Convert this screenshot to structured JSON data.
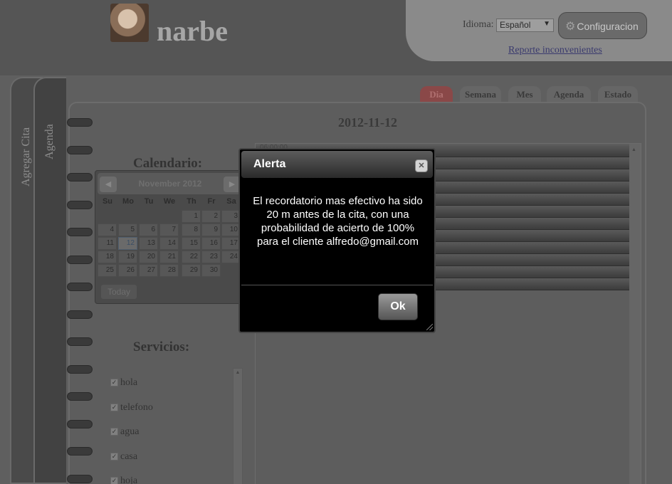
{
  "header": {
    "brand": "narbe",
    "language_label": "Idioma:",
    "language_selected": "Español",
    "config_button": "Configuracion",
    "report_link": "Reporte inconvenientes"
  },
  "side_tabs": [
    "Agregar Cita",
    "Agenda"
  ],
  "view_tabs": [
    "Dia",
    "Semana",
    "Mes",
    "Agenda",
    "Estado"
  ],
  "active_view_tab": "Dia",
  "main": {
    "date_title": "2012-11-12",
    "calendar_title": "Calendario:",
    "services_title": "Servicios:"
  },
  "calendar": {
    "month_label": "November 2012",
    "weekdays": [
      "Su",
      "Mo",
      "Tu",
      "We",
      "Th",
      "Fr",
      "Sa"
    ],
    "days": [
      "1",
      "2",
      "3",
      "4",
      "5",
      "6",
      "7",
      "8",
      "9",
      "10",
      "11",
      "12",
      "13",
      "14",
      "15",
      "16",
      "17",
      "18",
      "19",
      "20",
      "21",
      "22",
      "23",
      "24",
      "25",
      "26",
      "27",
      "28",
      "29",
      "30"
    ],
    "first_weekday_index": 4,
    "selected_day": "12",
    "today_button": "Today"
  },
  "services": [
    {
      "label": "hola",
      "checked": true
    },
    {
      "label": "telefono",
      "checked": true
    },
    {
      "label": "agua",
      "checked": true
    },
    {
      "label": "casa",
      "checked": true
    },
    {
      "label": "hoja",
      "checked": true
    }
  ],
  "schedule": {
    "first_slot_time": "06:00:00",
    "slot_count": 12
  },
  "modal": {
    "title": "Alerta",
    "message": "El recordatorio mas efectivo ha sido 20 m antes de la cita, con una probabilidad de acierto de 100% para el cliente alfredo@gmail.com",
    "ok_button": "Ok"
  }
}
